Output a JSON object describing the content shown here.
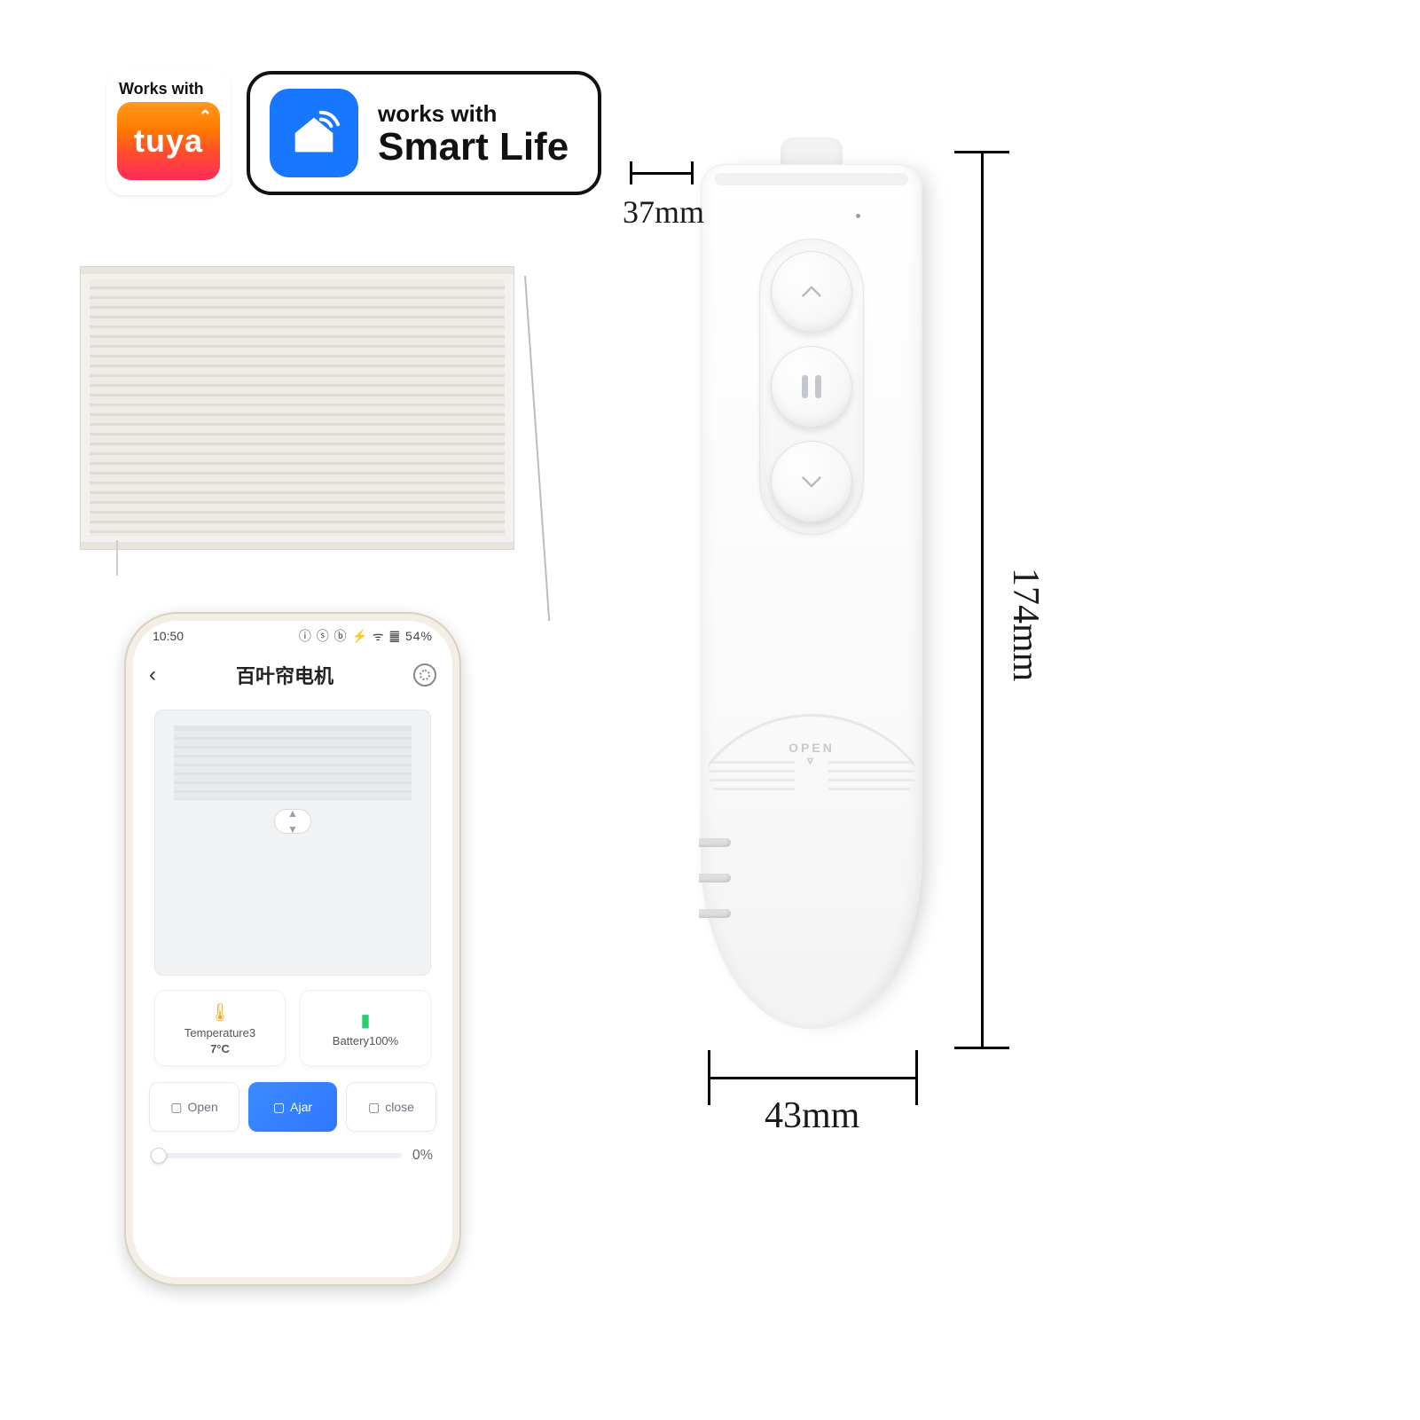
{
  "badges": {
    "tuya": {
      "works_with": "Works with",
      "brand": "tuya"
    },
    "smartlife": {
      "line1": "works with",
      "line2": "Smart Life"
    }
  },
  "dimensions": {
    "depth": "37mm",
    "height": "174mm",
    "width": "43mm"
  },
  "device": {
    "cap_label": "OPEN",
    "buttons": {
      "up": "up",
      "pause": "pause",
      "down": "down"
    }
  },
  "phone": {
    "status_time": "10:50",
    "status_icons": "ⓘ ⓢ ⓑ ⚡ ᯤ ䷀ 54%",
    "title": "百叶帘电机",
    "temperature": {
      "label": "Temperature3",
      "value": "7°C"
    },
    "battery": {
      "label": "Battery",
      "value": "100%"
    },
    "controls": {
      "open": "Open",
      "ajar": "Ajar",
      "close": "close"
    },
    "slider_pct": "0%"
  }
}
